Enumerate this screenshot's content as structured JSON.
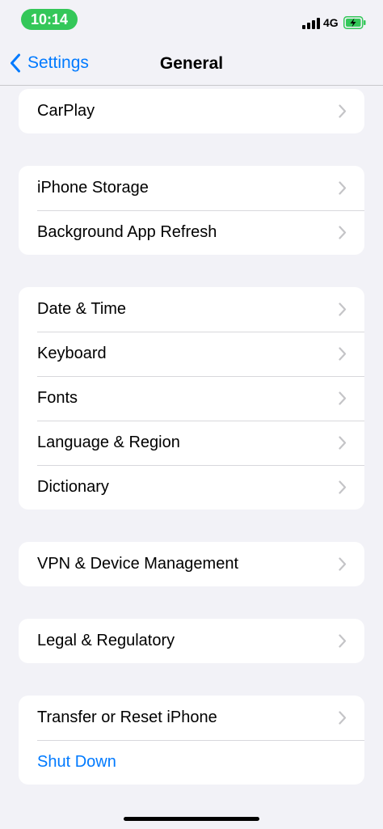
{
  "status_bar": {
    "time": "10:14",
    "network": "4G",
    "icons": [
      "cellular-signal-icon",
      "battery-charging-icon"
    ]
  },
  "nav": {
    "back_label": "Settings",
    "title": "General"
  },
  "groups": [
    {
      "items": [
        {
          "label": "CarPlay",
          "chevron": true
        }
      ]
    },
    {
      "items": [
        {
          "label": "iPhone Storage",
          "chevron": true
        },
        {
          "label": "Background App Refresh",
          "chevron": true
        }
      ]
    },
    {
      "items": [
        {
          "label": "Date & Time",
          "chevron": true
        },
        {
          "label": "Keyboard",
          "chevron": true
        },
        {
          "label": "Fonts",
          "chevron": true
        },
        {
          "label": "Language & Region",
          "chevron": true
        },
        {
          "label": "Dictionary",
          "chevron": true
        }
      ]
    },
    {
      "items": [
        {
          "label": "VPN & Device Management",
          "chevron": true
        }
      ]
    },
    {
      "items": [
        {
          "label": "Legal & Regulatory",
          "chevron": true
        }
      ]
    },
    {
      "items": [
        {
          "label": "Transfer or Reset iPhone",
          "chevron": true
        },
        {
          "label": "Shut Down",
          "chevron": false,
          "color": "#007aff"
        }
      ]
    }
  ],
  "colors": {
    "accent": "#007aff",
    "time_pill": "#34c759",
    "background": "#f2f2f7"
  }
}
